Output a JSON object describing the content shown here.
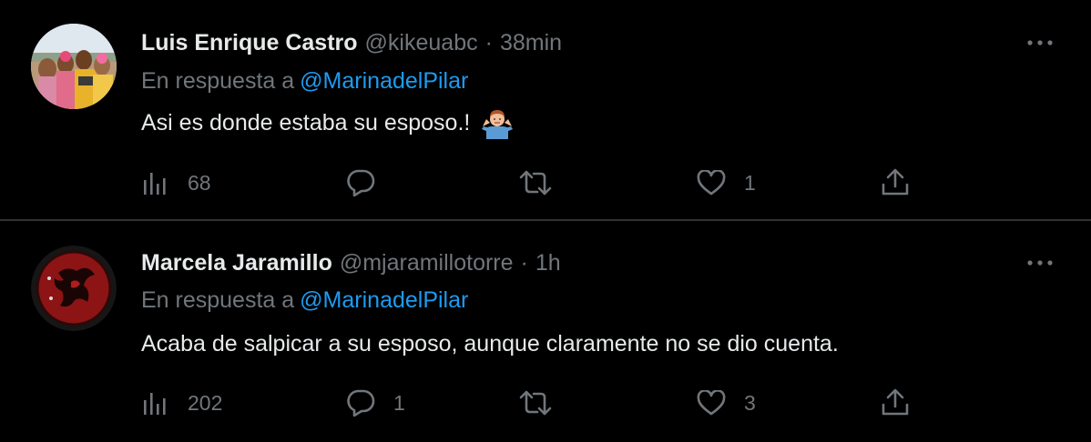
{
  "tweets": [
    {
      "name": "Luis Enrique Castro",
      "handle": "@kikeuabc",
      "separator": "·",
      "time": "38min",
      "reply_prefix": "En respuesta a",
      "reply_to": "@MarinadelPilar",
      "text": "Asi es donde estaba su esposo.!",
      "emoji": "person-shrugging-emoji",
      "views": "68",
      "replies": "",
      "retweets": "",
      "likes": "1"
    },
    {
      "name": "Marcela Jaramillo",
      "handle": "@mjaramillotorre",
      "separator": "·",
      "time": "1h",
      "reply_prefix": "En respuesta a",
      "reply_to": "@MarinadelPilar",
      "text": "Acaba de salpicar a su esposo, aunque claramente no se dio cuenta.",
      "views": "202",
      "replies": "1",
      "retweets": "",
      "likes": "3"
    }
  ],
  "colors": {
    "background": "#000000",
    "primary_text": "#e7e9ea",
    "secondary_text": "#71767b",
    "accent": "#1d9bf0",
    "divider": "#2f3336"
  }
}
